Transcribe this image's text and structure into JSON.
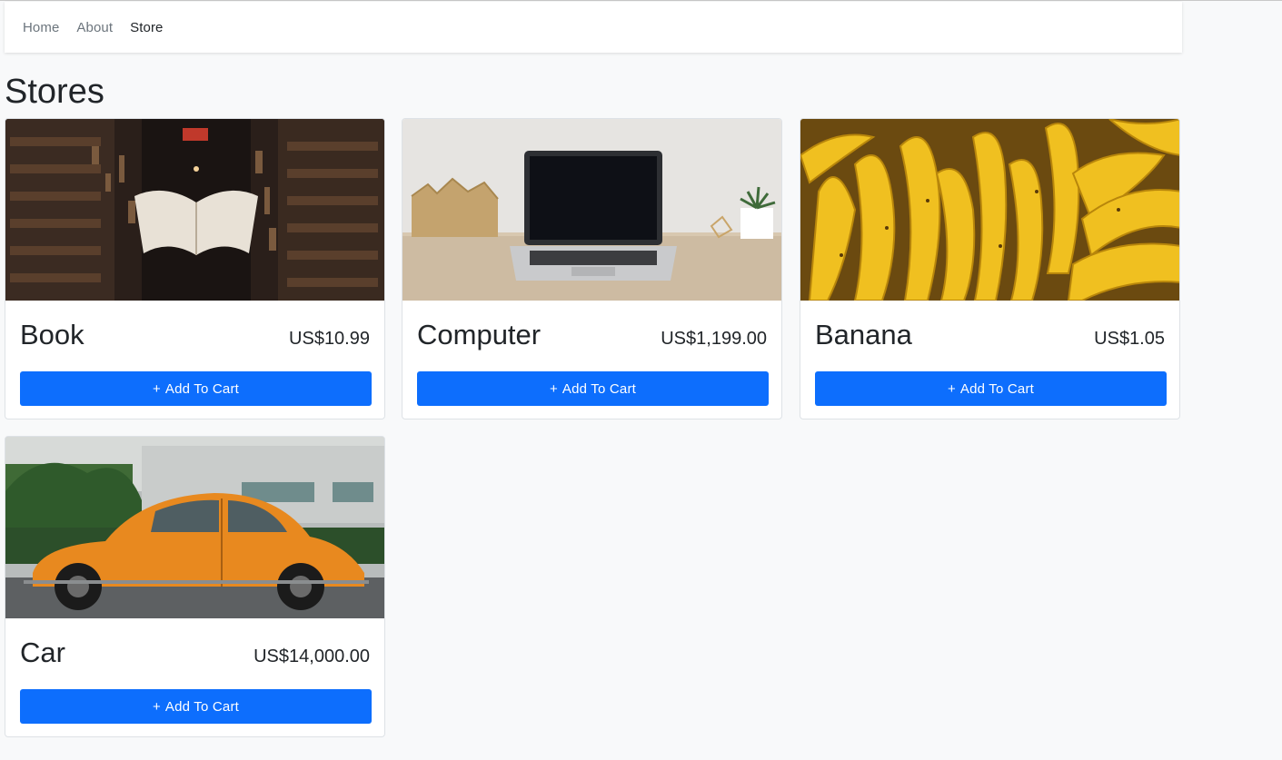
{
  "nav": {
    "items": [
      {
        "label": "Home"
      },
      {
        "label": "About"
      },
      {
        "label": "Store"
      }
    ]
  },
  "page": {
    "title": "Stores"
  },
  "products": [
    {
      "name": "Book",
      "price": "US$10.99",
      "button_label": "Add To Cart",
      "button_icon": "+",
      "image": "book-shelf-photo"
    },
    {
      "name": "Computer",
      "price": "US$1,199.00",
      "button_label": "Add To Cart",
      "button_icon": "+",
      "image": "laptop-desk-photo"
    },
    {
      "name": "Banana",
      "price": "US$1.05",
      "button_label": "Add To Cart",
      "button_icon": "+",
      "image": "bananas-photo"
    },
    {
      "name": "Car",
      "price": "US$14,000.00",
      "button_label": "Add To Cart",
      "button_icon": "+",
      "image": "orange-beetle-car-photo"
    }
  ],
  "colors": {
    "primary": "#0d6efd",
    "background": "#f8f9fa",
    "nav_muted": "#6c757d",
    "text": "#212529"
  }
}
